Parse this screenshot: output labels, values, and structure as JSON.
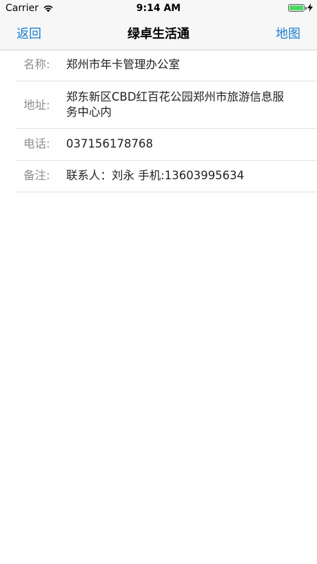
{
  "status": {
    "carrier": "Carrier",
    "time": "9:14 AM",
    "battery_level": 1.0,
    "battery_color": "#4cd964"
  },
  "nav": {
    "back_label": "返回",
    "title": "绿卓生活通",
    "map_label": "地图",
    "accent": "#1a7ed0"
  },
  "details": [
    {
      "label": "名称:",
      "value": "郑州市年卡管理办公室"
    },
    {
      "label": "地址:",
      "value": "郑东新区CBD红百花公园郑州市旅游信息服务中心内"
    },
    {
      "label": "电话:",
      "value": "037156178768"
    },
    {
      "label": "备注:",
      "value": "联系人：刘永 手机:13603995634"
    }
  ],
  "icons": {
    "wifi": "wifi-icon",
    "battery": "battery-icon",
    "charging": "charging-bolt-icon"
  }
}
